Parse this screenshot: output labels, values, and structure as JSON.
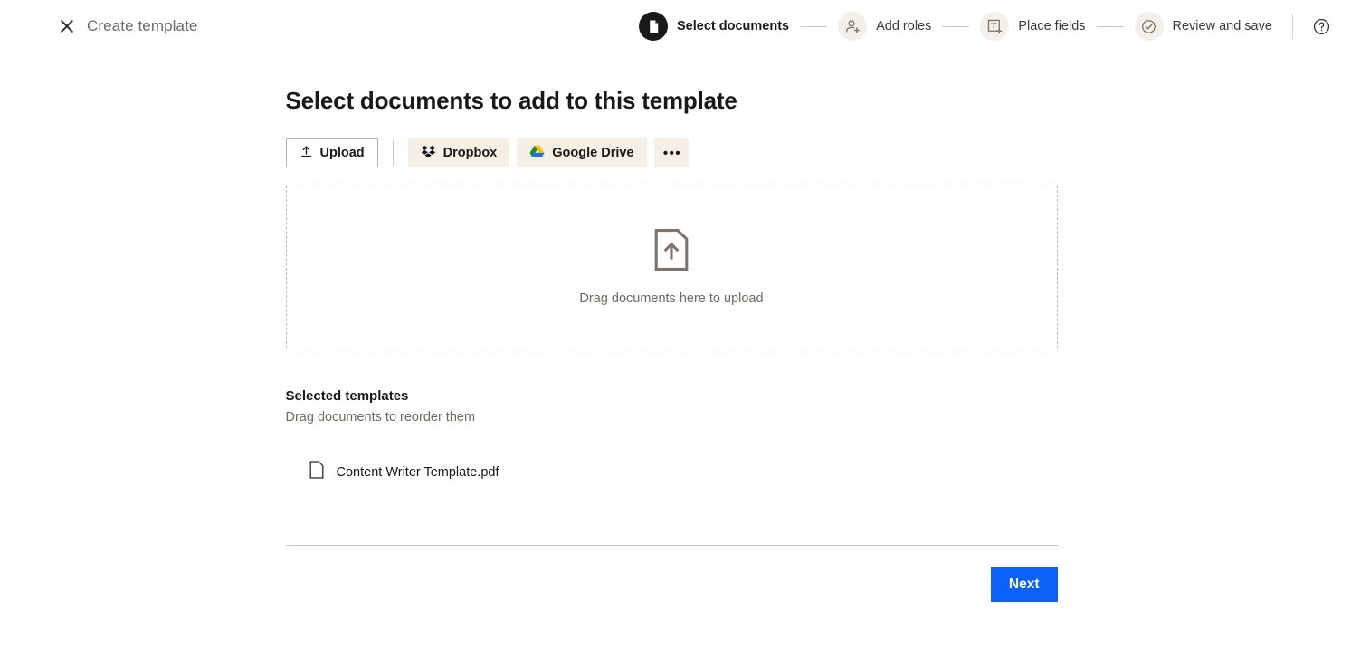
{
  "topbar": {
    "close_icon": "close-icon",
    "title": "Create template",
    "help_icon": "help-circle-icon",
    "steps": [
      {
        "label": "Select documents",
        "icon": "document-icon",
        "active": true
      },
      {
        "label": "Add roles",
        "icon": "person-add-icon",
        "active": false
      },
      {
        "label": "Place fields",
        "icon": "text-field-add-icon",
        "active": false
      },
      {
        "label": "Review and save",
        "icon": "check-circle-icon",
        "active": false
      }
    ]
  },
  "main": {
    "title": "Select documents to add to this template",
    "sources": {
      "upload_label": "Upload",
      "upload_icon": "upload-arrow-icon",
      "dropbox_label": "Dropbox",
      "dropbox_icon": "dropbox-icon",
      "google_drive_label": "Google Drive",
      "google_drive_icon": "google-drive-icon",
      "more_label": "•••",
      "more_icon": "more-options-icon"
    },
    "dropzone": {
      "icon": "document-upload-icon",
      "text": "Drag documents here to upload"
    },
    "selected": {
      "heading": "Selected templates",
      "subtext": "Drag documents to reorder them",
      "files": [
        {
          "name": "Content Writer Template.pdf",
          "icon": "file-icon"
        }
      ]
    },
    "footer": {
      "next_label": "Next"
    }
  },
  "colors": {
    "accent_blue": "#0b62fb",
    "source_button_bg": "#f6efe5",
    "step_badge_bg": "#f3efe9",
    "step_active_bg": "#191919",
    "muted_text": "#6f6962",
    "border": "#cfc9c1"
  }
}
